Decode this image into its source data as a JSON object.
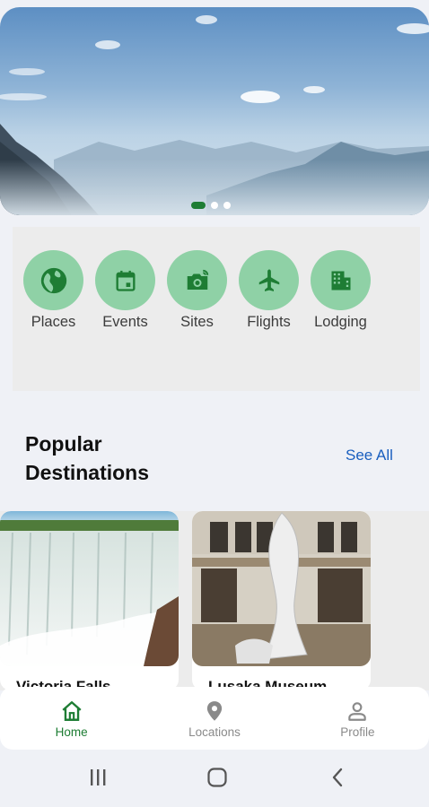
{
  "hero": {
    "slide_count": 3,
    "active_slide": 1
  },
  "categories": [
    {
      "label": "Places",
      "icon": "globe-icon"
    },
    {
      "label": "Events",
      "icon": "calendar-icon"
    },
    {
      "label": "Sites",
      "icon": "camera-icon"
    },
    {
      "label": "Flights",
      "icon": "airplane-icon"
    },
    {
      "label": "Lodging",
      "icon": "building-icon"
    }
  ],
  "popular": {
    "title": "Popular Destinations",
    "see_all": "See All",
    "cards": [
      {
        "title": "Victoria Falls"
      },
      {
        "title": "Lusaka Museum"
      }
    ]
  },
  "bottom_nav": {
    "items": [
      {
        "label": "Home",
        "icon": "home-icon",
        "active": true
      },
      {
        "label": "Locations",
        "icon": "location-pin-icon",
        "active": false
      },
      {
        "label": "Profile",
        "icon": "person-icon",
        "active": false
      }
    ]
  },
  "colors": {
    "accent": "#1e7d34",
    "category_circle": "#8fd1a6",
    "link": "#1a5fbf"
  }
}
